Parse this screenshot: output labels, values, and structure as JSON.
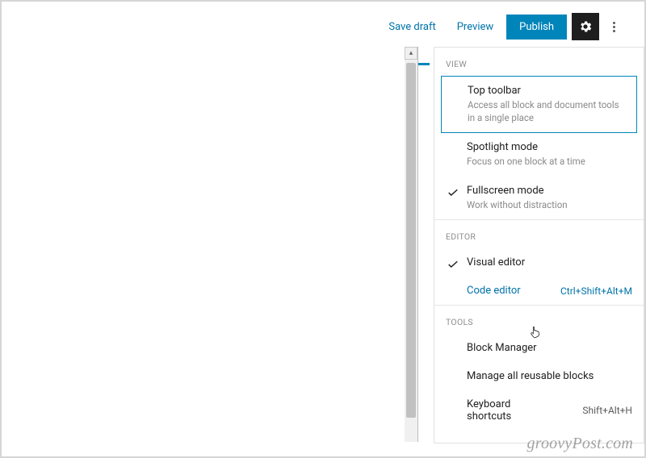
{
  "topbar": {
    "save_draft": "Save draft",
    "preview": "Preview",
    "publish": "Publish"
  },
  "panel": {
    "view_label": "VIEW",
    "editor_label": "EDITOR",
    "tools_label": "TOOLS",
    "view": {
      "top_toolbar": {
        "title": "Top toolbar",
        "desc": "Access all block and document tools in a single place"
      },
      "spotlight": {
        "title": "Spotlight mode",
        "desc": "Focus on one block at a time"
      },
      "fullscreen": {
        "title": "Fullscreen mode",
        "desc": "Work without distraction"
      }
    },
    "editor": {
      "visual": {
        "title": "Visual editor"
      },
      "code": {
        "title": "Code editor",
        "shortcut": "Ctrl+Shift+Alt+M"
      }
    },
    "tools": {
      "block_manager": "Block Manager",
      "reusable": "Manage all reusable blocks",
      "keyboard": {
        "title": "Keyboard shortcuts",
        "shortcut": "Shift+Alt+H"
      }
    }
  },
  "watermark": "groovyPost.com"
}
